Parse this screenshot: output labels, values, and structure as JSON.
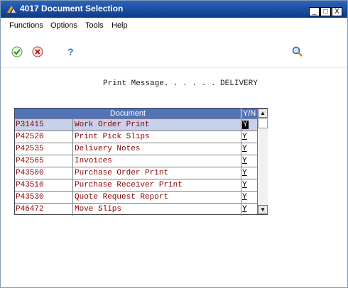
{
  "window": {
    "title": "4017  Document Selection",
    "minimize": "_",
    "maximize": "□",
    "close": "X"
  },
  "menu": [
    "Functions",
    "Options",
    "Tools",
    "Help"
  ],
  "toolbar": {
    "ok_icon": "check-icon",
    "cancel_icon": "cancel-icon",
    "help_icon": "help-icon",
    "help_glyph": "?",
    "search_icon": "search-icon"
  },
  "form": {
    "label": "Print Message. . . . . .",
    "value": "DELIVERY"
  },
  "grid": {
    "headers": {
      "document": "Document",
      "yn": "Y/N"
    },
    "rows": [
      {
        "code": "P31415",
        "name": "Work Order Print",
        "yn": "Y"
      },
      {
        "code": "P42520",
        "name": "Print Pick Slips",
        "yn": "Y"
      },
      {
        "code": "P42535",
        "name": "Delivery Notes",
        "yn": "Y"
      },
      {
        "code": "P42565",
        "name": "Invoices",
        "yn": "Y"
      },
      {
        "code": "P43500",
        "name": "Purchase Order Print",
        "yn": "Y"
      },
      {
        "code": "P43510",
        "name": "Purchase Receiver Print",
        "yn": "Y"
      },
      {
        "code": "P43530",
        "name": "Quote Request Report",
        "yn": "Y"
      },
      {
        "code": "P46472",
        "name": "Move Slips",
        "yn": "Y"
      }
    ]
  },
  "colors": {
    "titlebar": "#0d3a8a",
    "grid_header": "#5273b8",
    "code_text": "#8b0000"
  }
}
